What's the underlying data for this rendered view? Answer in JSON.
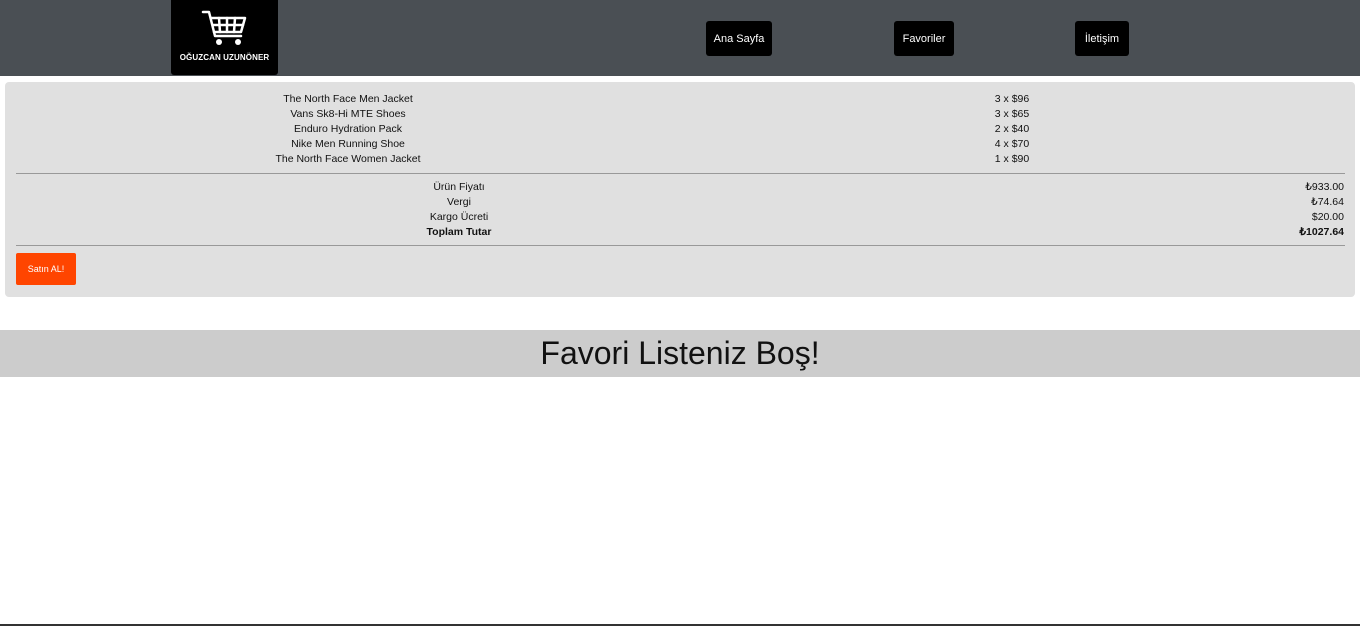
{
  "header": {
    "brand": "OĞUZCAN UZUNÖNER",
    "nav": [
      "Ana Sayfa",
      "Favoriler",
      "İletişim"
    ],
    "logo_icon": "shopping-cart-icon"
  },
  "cart": {
    "items": [
      {
        "name": "The North Face Men Jacket",
        "qty": "3 x $96"
      },
      {
        "name": "Vans Sk8-Hi MTE Shoes",
        "qty": "3 x $65"
      },
      {
        "name": "Enduro Hydration Pack",
        "qty": "2 x $40"
      },
      {
        "name": "Nike Men Running Shoe",
        "qty": "4 x $70"
      },
      {
        "name": "The North Face Women Jacket",
        "qty": "1 x $90"
      }
    ],
    "summary": [
      {
        "label": "Ürün Fiyatı",
        "value": "₺933.00"
      },
      {
        "label": "Vergi",
        "value": "₺74.64"
      },
      {
        "label": "Kargo Ücreti",
        "value": "$20.00"
      },
      {
        "label": "Toplam Tutar",
        "value": "₺1027.64"
      }
    ],
    "buy_label": "Satın AL!"
  },
  "favorites": {
    "empty_message": "Favori Listeniz Boş!"
  },
  "colors": {
    "header_bg": "#4a4f54",
    "panel_bg": "#e0e0e0",
    "buy_button": "#ff4500",
    "banner_bg": "#cccccc"
  }
}
